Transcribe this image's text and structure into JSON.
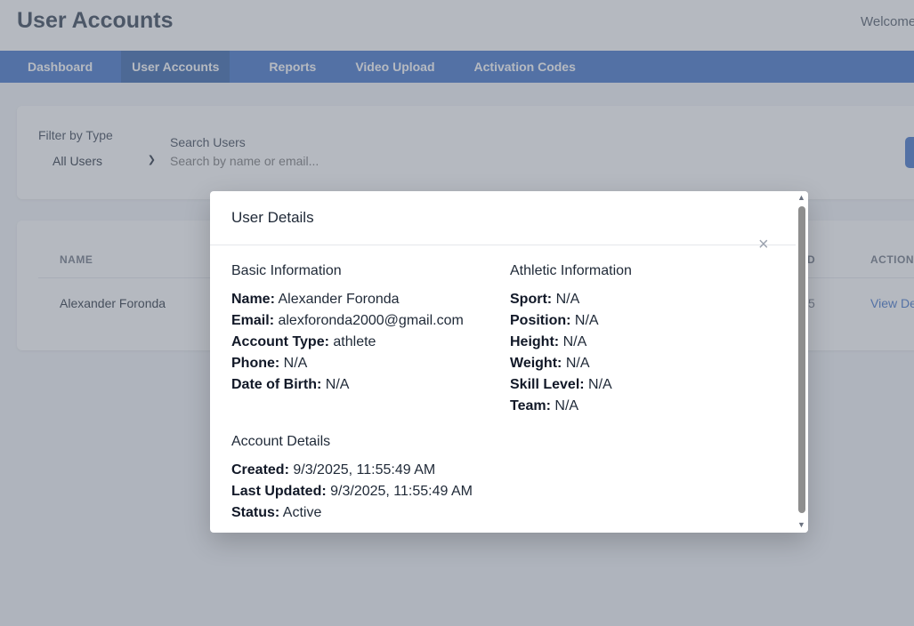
{
  "header": {
    "title": "User Accounts",
    "welcome": "Welcome"
  },
  "nav": {
    "tabs": [
      "Dashboard",
      "User Accounts",
      "Reports",
      "Video Upload",
      "Activation Codes"
    ],
    "active": "User Accounts"
  },
  "filters": {
    "type_label": "Filter by Type",
    "type_value": "All Users",
    "search_label": "Search Users",
    "search_placeholder": "Search by name or email..."
  },
  "table": {
    "headers": {
      "name": "NAME",
      "col_partial": "D",
      "actions": "ACTION"
    },
    "rows": [
      {
        "name": "Alexander Foronda",
        "partial_value": "5",
        "action": "View De"
      }
    ]
  },
  "modal": {
    "title": "User Details",
    "close_symbol": "×",
    "basic": {
      "title": "Basic Information",
      "name_label": "Name:",
      "name": "Alexander Foronda",
      "email_label": "Email:",
      "email": "alexforonda2000@gmail.com",
      "type_label": "Account Type:",
      "type": "athlete",
      "phone_label": "Phone:",
      "phone": "N/A",
      "dob_label": "Date of Birth:",
      "dob": "N/A"
    },
    "athletic": {
      "title": "Athletic Information",
      "sport_label": "Sport:",
      "sport": "N/A",
      "position_label": "Position:",
      "position": "N/A",
      "height_label": "Height:",
      "height": "N/A",
      "weight_label": "Weight:",
      "weight": "N/A",
      "skill_label": "Skill Level:",
      "skill": "N/A",
      "team_label": "Team:",
      "team": "N/A"
    },
    "account": {
      "title": "Account Details",
      "created_label": "Created:",
      "created": "9/3/2025, 11:55:49 AM",
      "updated_label": "Last Updated:",
      "updated": "9/3/2025, 11:55:49 AM",
      "status_label": "Status:",
      "status": "Active"
    }
  },
  "colors": {
    "nav": "#3b6fc9",
    "nav_active": "#2f5ea8",
    "link": "#3b6fc9",
    "overlay": "#6b7482"
  }
}
